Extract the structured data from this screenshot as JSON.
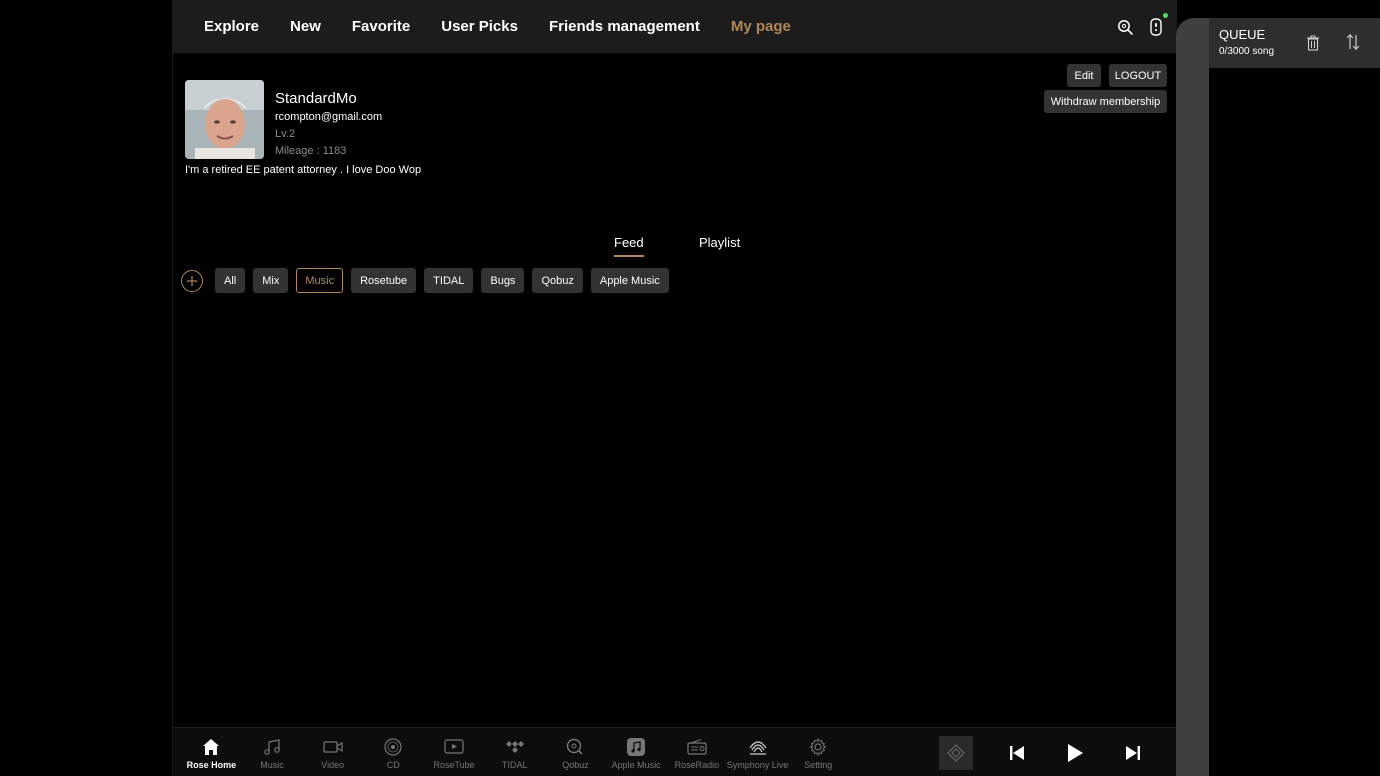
{
  "topnav": {
    "tabs": [
      "Explore",
      "New",
      "Favorite",
      "User Picks",
      "Friends management",
      "My page"
    ],
    "active_tab": "My page",
    "icons": [
      "search-icon",
      "remote-icon"
    ]
  },
  "profile": {
    "name": "StandardMo",
    "email": "rcompton@gmail.com",
    "level": "Lv.2",
    "mileage": "Mileage : 1183",
    "bio": "I'm a retired EE patent  attorney . I love Doo Wop"
  },
  "actions": {
    "edit": "Edit",
    "logout": "LOGOUT",
    "withdraw": "Withdraw membership"
  },
  "subtabs": {
    "feed": "Feed",
    "playlist": "Playlist",
    "active": "Feed"
  },
  "filters": {
    "chips": [
      "All",
      "Mix",
      "Music",
      "Rosetube",
      "TIDAL",
      "Bugs",
      "Qobuz",
      "Apple Music"
    ],
    "active": "Music"
  },
  "bottom_nav": [
    {
      "label": "Rose Home",
      "icon": "home-icon"
    },
    {
      "label": "Music",
      "icon": "music-note-icon"
    },
    {
      "label": "Video",
      "icon": "video-icon"
    },
    {
      "label": "CD",
      "icon": "cd-icon"
    },
    {
      "label": "RoseTube",
      "icon": "rosetube-icon"
    },
    {
      "label": "TIDAL",
      "icon": "tidal-icon"
    },
    {
      "label": "Qobuz",
      "icon": "qobuz-icon"
    },
    {
      "label": "Apple Music",
      "icon": "apple-music-icon"
    },
    {
      "label": "RoseRadio",
      "icon": "radio-icon"
    },
    {
      "label": "Symphony Live",
      "icon": "symphony-icon"
    },
    {
      "label": "Setting",
      "icon": "gear-icon"
    }
  ],
  "queue": {
    "title": "QUEUE",
    "count": "0/3000 song"
  },
  "colors": {
    "accent": "#b18658",
    "nav_bg": "#1c1c1c",
    "chip_bg": "#333333",
    "queue_head_bg": "#2e2e2e"
  }
}
